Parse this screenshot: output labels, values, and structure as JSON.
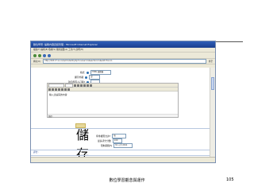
{
  "slide": {
    "caption": "數位學習觀念與運作",
    "page_number": "105"
  },
  "browser": {
    "title": "數位學習: 編輯內容資訊管理 - Microsoft Internet Explorer",
    "menu": "檔案(F)  編輯(E)  檢視(V)  我的最愛(A)  工具(T)  說明(H)",
    "address_label": "網址(D)",
    "url": "http://163.17.xx.xx/ls/modedit.php?course=xx&section=x&add=forum",
    "go_label": "移至"
  },
  "form": {
    "fields": [
      {
        "label": "格式",
        "value": "HTML 編輯器"
      },
      {
        "label": "顯示外觀",
        "value": "是"
      },
      {
        "label": "強迫所有人訂閱?",
        "value": ""
      },
      {
        "label": "追蹤閱讀?",
        "value": ""
      },
      {
        "label": "一般訊息",
        "value": ""
      }
    ],
    "editor_font": "Trebuchet",
    "editor_text": "輸入討論區的內容",
    "path_label": "路徑:",
    "save_label": "儲存",
    "rating_label": "尊重權限允許?",
    "rating_value": "無",
    "more_label": "最多評分分數",
    "more_value": "100",
    "from_label": "限制期間內",
    "from_value": "31  八月  2011",
    "section2_label": "評分:",
    "group_label": "群組",
    "group_value": "無"
  }
}
